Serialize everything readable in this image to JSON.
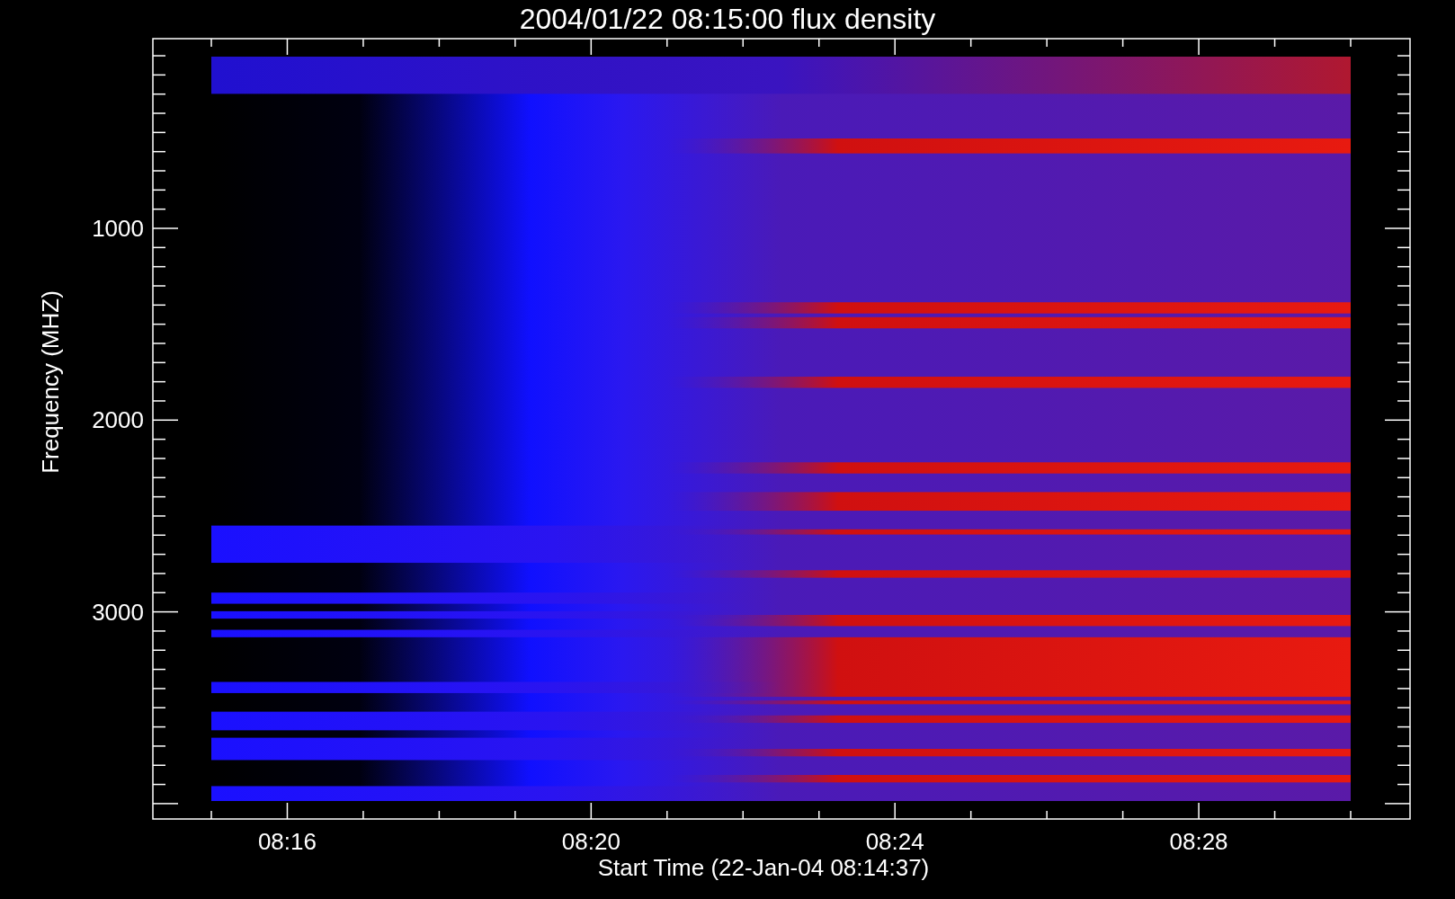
{
  "title": "2004/01/22 08:15:00 flux density",
  "y_axis": {
    "label": "Frequency (MHZ)",
    "ticks": [
      "1000",
      "2000",
      "3000"
    ]
  },
  "x_axis": {
    "label": "Start Time (22-Jan-04 08:14:37)",
    "ticks": [
      "08:16",
      "08:20",
      "08:24",
      "08:28"
    ]
  }
}
